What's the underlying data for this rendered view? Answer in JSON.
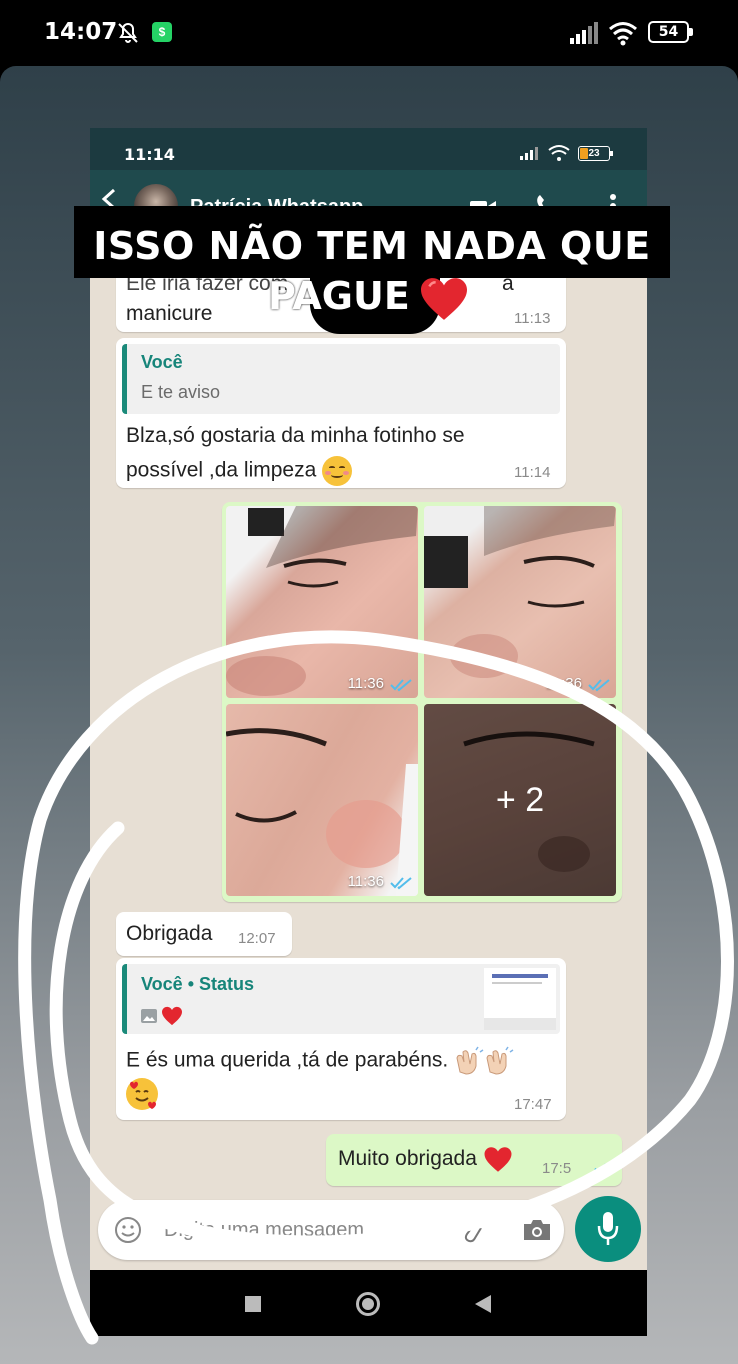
{
  "outer_status": {
    "time": "14:07",
    "battery": "54"
  },
  "inner_status": {
    "time": "11:14",
    "battery": "23"
  },
  "chat_header": {
    "contact_name": "Patrícia Whatsapp"
  },
  "messages": {
    "m1": {
      "text_line1": "Ele iria fazer com",
      "text_line1_end": "a",
      "text_line2": "manicure",
      "time": "11:13"
    },
    "m2": {
      "quote_author": "Você",
      "quote_text": "E te aviso",
      "text_line1": "Blza,só gostaria da minha fotinho se",
      "text_line2": "possível ,da limpeza",
      "time": "11:14"
    },
    "photos": {
      "times": [
        "11:36",
        "11:36",
        "11:36"
      ],
      "more_count": "+ 2"
    },
    "m3": {
      "text": "Obrigada",
      "time": "12:07"
    },
    "m4": {
      "quote_author": "Você • Status",
      "text": "E és uma querida ,tá de parabéns.",
      "time": "17:47"
    },
    "m5": {
      "text": "Muito obrigada",
      "time": "17:5"
    }
  },
  "input": {
    "placeholder": "Digite uma mensagem"
  },
  "story_caption": {
    "line1": "ISSO NÃO TEM NADA QUE",
    "line2": "PAGUE"
  },
  "colors": {
    "header": "#1f4a4d",
    "outgoing": "#dcf8c6",
    "accent": "#0a8e7e",
    "heart": "#e3262f"
  }
}
